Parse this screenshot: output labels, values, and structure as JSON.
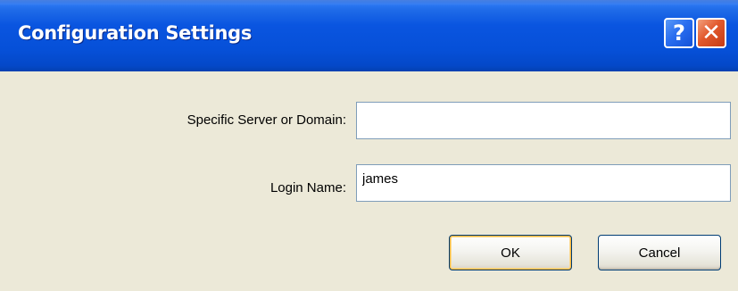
{
  "window": {
    "title": "Configuration Settings",
    "help_button_label": "?",
    "close_button_label": "✕"
  },
  "form": {
    "server": {
      "label": "Specific Server or Domain:",
      "value": "",
      "placeholder": ""
    },
    "login": {
      "label": "Login Name:",
      "value": "james",
      "placeholder": ""
    }
  },
  "buttons": {
    "ok_label": "OK",
    "cancel_label": "Cancel"
  },
  "colors": {
    "titlebar": "#0a55e0",
    "dialog_background": "#ece9d8",
    "close_button": "#e2592d",
    "help_button": "#2a6ef0",
    "default_button_highlight": "#f8b73c"
  }
}
